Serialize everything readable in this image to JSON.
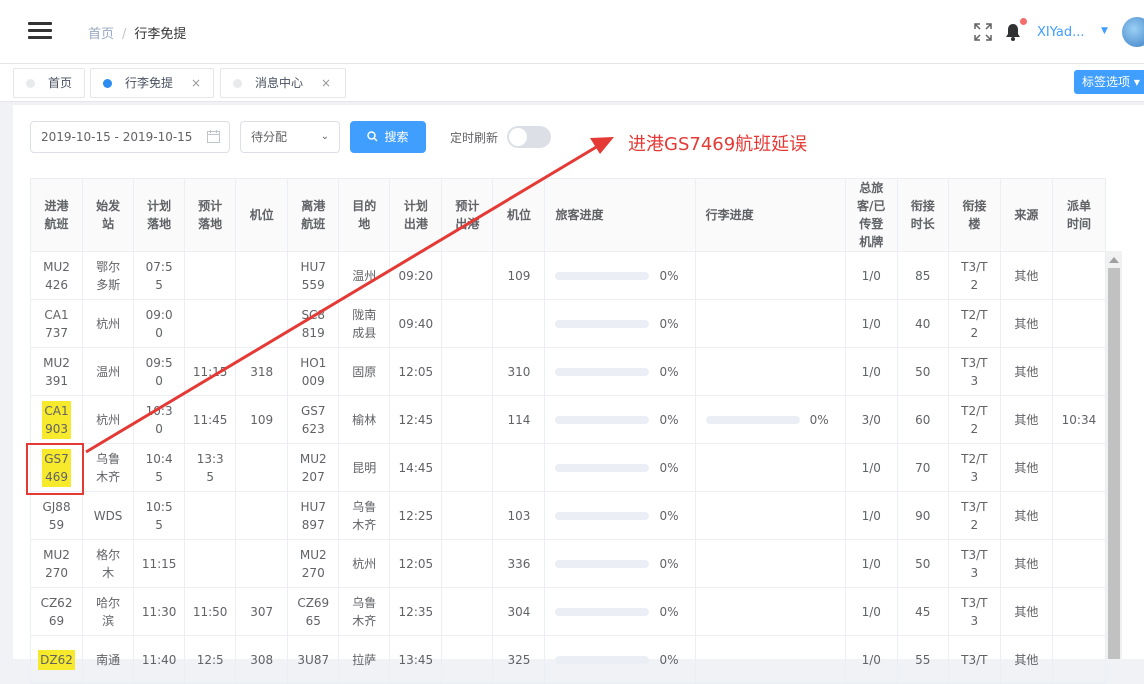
{
  "header": {
    "breadcrumb_home": "首页",
    "breadcrumb_sep": "/",
    "breadcrumb_current": "行李免提",
    "user_name": "XIYad..."
  },
  "tags": {
    "items": [
      {
        "label": "首页"
      },
      {
        "label": "行李免提"
      },
      {
        "label": "消息中心"
      }
    ],
    "close": "×",
    "options_label": "标签选项"
  },
  "filters": {
    "date_range": "2019-10-15 - 2019-10-15",
    "status_select": "待分配",
    "search_label": "搜索",
    "timer_label": "定时刷新",
    "timer_on": false
  },
  "table": {
    "headers": [
      "进港\n航班",
      "始发\n站",
      "计划\n落地",
      "预计\n落地",
      "机位",
      "离港\n航班",
      "目的\n地",
      "计划\n出港",
      "预计\n出港",
      "机位",
      "旅客进度",
      "行李进度",
      "总旅\n客/已\n传登\n机牌",
      "衔接\n时长",
      "衔接\n楼",
      "来源",
      "派单\n时间"
    ],
    "rows": [
      {
        "cells": [
          "MU2\n426",
          "鄂尔\n多斯",
          "07:5\n5",
          "",
          "",
          "HU7\n559",
          "温州",
          "09:20",
          "",
          "109",
          "",
          "",
          "1/0",
          "85",
          "T3/T\n2",
          "其他",
          ""
        ],
        "pax": "0%",
        "bag": "",
        "highlight": false
      },
      {
        "cells": [
          "CA1\n737",
          "杭州",
          "09:0\n0",
          "",
          "",
          "SC8\n819",
          "陇南\n成县",
          "09:40",
          "",
          "",
          "",
          "",
          "1/0",
          "40",
          "T2/T\n2",
          "其他",
          ""
        ],
        "pax": "0%",
        "bag": "",
        "highlight": false
      },
      {
        "cells": [
          "MU2\n391",
          "温州",
          "09:5\n0",
          "11:15",
          "318",
          "HO1\n009",
          "固原",
          "12:05",
          "",
          "310",
          "",
          "",
          "1/0",
          "50",
          "T3/T\n3",
          "其他",
          ""
        ],
        "pax": "0%",
        "bag": "",
        "highlight": false
      },
      {
        "cells": [
          "CA1\n903",
          "杭州",
          "10:3\n0",
          "11:45",
          "109",
          "GS7\n623",
          "榆林",
          "12:45",
          "",
          "114",
          "",
          "",
          "3/0",
          "60",
          "T2/T\n2",
          "其他",
          "10:34"
        ],
        "pax": "0%",
        "bag": "0%",
        "highlight": true
      },
      {
        "cells": [
          "GS7\n469",
          "乌鲁\n木齐",
          "10:4\n5",
          "13:3\n5",
          "",
          "MU2\n207",
          "昆明",
          "14:45",
          "",
          "",
          "",
          "",
          "1/0",
          "70",
          "T2/T\n3",
          "其他",
          ""
        ],
        "pax": "0%",
        "bag": "",
        "highlight": true
      },
      {
        "cells": [
          "GJ88\n59",
          "WDS",
          "10:5\n5",
          "",
          "",
          "HU7\n897",
          "乌鲁\n木齐",
          "12:25",
          "",
          "103",
          "",
          "",
          "1/0",
          "90",
          "T3/T\n2",
          "其他",
          ""
        ],
        "pax": "0%",
        "bag": "",
        "highlight": false
      },
      {
        "cells": [
          "MU2\n270",
          "格尔\n木",
          "11:15",
          "",
          "",
          "MU2\n270",
          "杭州",
          "12:05",
          "",
          "336",
          "",
          "",
          "1/0",
          "50",
          "T3/T\n3",
          "其他",
          ""
        ],
        "pax": "0%",
        "bag": "",
        "highlight": false
      },
      {
        "cells": [
          "CZ62\n69",
          "哈尔\n滨",
          "11:30",
          "11:50",
          "307",
          "CZ69\n65",
          "乌鲁\n木齐",
          "12:35",
          "",
          "304",
          "",
          "",
          "1/0",
          "45",
          "T3/T\n3",
          "其他",
          ""
        ],
        "pax": "0%",
        "bag": "",
        "highlight": false
      },
      {
        "cells": [
          "DZ62\n",
          "南通",
          "11:40",
          "12:5\n",
          "308",
          "3U87\n",
          "拉萨",
          "13:45",
          "",
          "325",
          "",
          "",
          "1/0",
          "55",
          "T3/T\n",
          "其他",
          ""
        ],
        "pax": "0%",
        "bag": "",
        "highlight": true
      }
    ]
  },
  "annotation": {
    "text": "进港GS7469航班延误",
    "color": "#e53935"
  },
  "colors": {
    "primary": "#409eff",
    "highlight": "#f7e92c",
    "alert_dot": "#f56c6c"
  }
}
